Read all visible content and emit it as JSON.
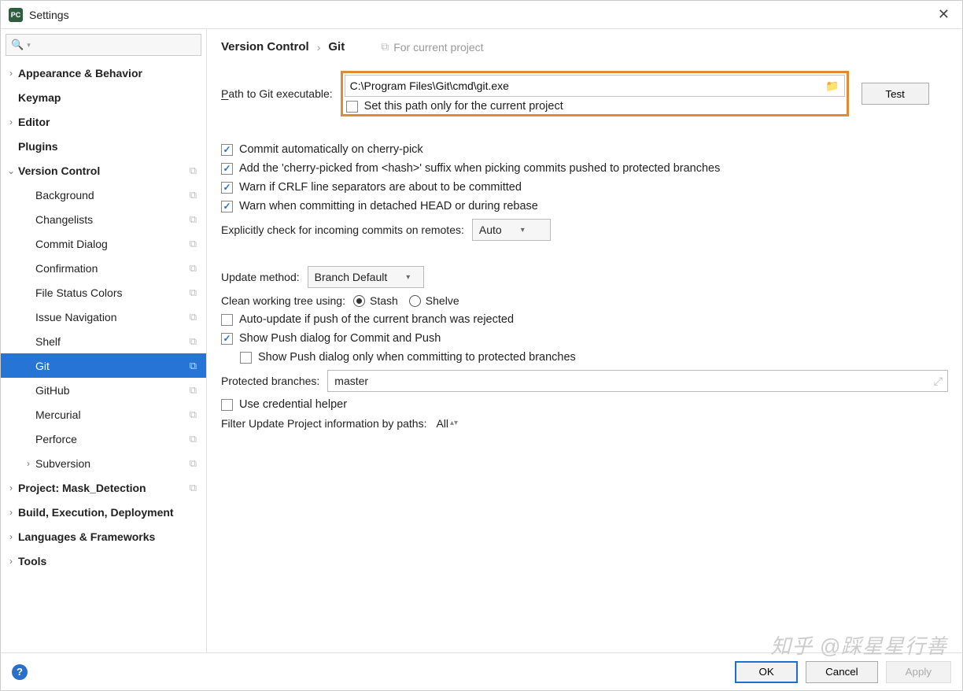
{
  "titlebar": {
    "app_icon_text": "PC",
    "title": "Settings"
  },
  "sidebar": {
    "search_placeholder": "",
    "items": [
      {
        "label": "Appearance & Behavior",
        "bold": true,
        "expandable": true,
        "expanded": false,
        "depth": 0
      },
      {
        "label": "Keymap",
        "bold": true,
        "depth": 0
      },
      {
        "label": "Editor",
        "bold": true,
        "expandable": true,
        "expanded": false,
        "depth": 0
      },
      {
        "label": "Plugins",
        "bold": true,
        "depth": 0
      },
      {
        "label": "Version Control",
        "bold": true,
        "expandable": true,
        "expanded": true,
        "depth": 0,
        "copy": true
      },
      {
        "label": "Background",
        "depth": 1,
        "copy": true
      },
      {
        "label": "Changelists",
        "depth": 1,
        "copy": true
      },
      {
        "label": "Commit Dialog",
        "depth": 1,
        "copy": true
      },
      {
        "label": "Confirmation",
        "depth": 1,
        "copy": true
      },
      {
        "label": "File Status Colors",
        "depth": 1,
        "copy": true
      },
      {
        "label": "Issue Navigation",
        "depth": 1,
        "copy": true
      },
      {
        "label": "Shelf",
        "depth": 1,
        "copy": true
      },
      {
        "label": "Git",
        "depth": 1,
        "copy": true,
        "selected": true
      },
      {
        "label": "GitHub",
        "depth": 1,
        "copy": true
      },
      {
        "label": "Mercurial",
        "depth": 1,
        "copy": true
      },
      {
        "label": "Perforce",
        "depth": 1,
        "copy": true
      },
      {
        "label": "Subversion",
        "expandable": true,
        "expanded": false,
        "depth": 1,
        "copy": true
      },
      {
        "label": "Project: Mask_Detection",
        "bold": true,
        "expandable": true,
        "expanded": false,
        "depth": 0,
        "copy": true
      },
      {
        "label": "Build, Execution, Deployment",
        "bold": true,
        "expandable": true,
        "expanded": false,
        "depth": 0
      },
      {
        "label": "Languages & Frameworks",
        "bold": true,
        "expandable": true,
        "expanded": false,
        "depth": 0
      },
      {
        "label": "Tools",
        "bold": true,
        "expandable": true,
        "expanded": false,
        "depth": 0
      }
    ]
  },
  "crumbs": {
    "a": "Version Control",
    "b": "Git",
    "for_project": "For current project"
  },
  "git": {
    "path_label_pre": "P",
    "path_label_rest": "ath to Git executable:",
    "path_value": "C:\\Program Files\\Git\\cmd\\git.exe",
    "test_btn": "Test",
    "set_path_only": "Set this path only for the current project",
    "commit_auto": "Commit automatically on cherry-pick",
    "add_suffix": "Add the 'cherry-picked from <hash>' suffix when picking commits pushed to protected branches",
    "warn_crlf": "Warn if CRLF line separators are about to be committed",
    "warn_detached": "Warn when committing in detached HEAD or during rebase",
    "explicit_check": "Explicitly check for incoming commits on remotes:",
    "explicit_check_value": "Auto",
    "update_method": "Update method:",
    "update_method_value": "Branch Default",
    "clean_tree": "Clean working tree using:",
    "stash": "Stash",
    "shelve": "Shelve",
    "auto_update": "Auto-update if push of the current branch was rejected",
    "show_push": "Show Push dialog for Commit and Push",
    "show_push_protected": "Show Push dialog only when committing to protected branches",
    "protected": "Protected branches:",
    "protected_value": "master",
    "credential": "Use credential helper",
    "filter_update": "Filter Update Project information by paths:",
    "filter_value": "All"
  },
  "footer": {
    "ok": "OK",
    "cancel": "Cancel",
    "apply": "Apply"
  },
  "watermark": "知乎 @踩星星行善"
}
